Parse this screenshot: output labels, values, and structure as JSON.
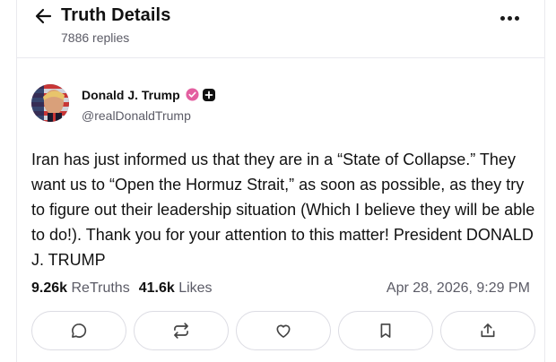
{
  "header": {
    "title": "Truth Details",
    "replies": "7886 replies"
  },
  "post": {
    "author_name": "Donald J. Trump",
    "author_handle": "@realDonaldTrump",
    "text": "Iran has just informed us that they are in a “State of Collapse.” They want us to “Open the Hormuz Strait,” as soon as possible, as they try to figure out their leadership situation (Which I believe they will be able to do!). Thank you for your attention to this matter! President DONALD J. TRUMP",
    "retruths_count": "9.26k",
    "retruths_label": "ReTruths",
    "likes_count": "41.6k",
    "likes_label": "Likes",
    "timestamp": "Apr 28, 2026, 9:29 PM"
  },
  "icons": {
    "back": "arrow-left-icon",
    "more": "more-horizontal-icon",
    "verified": "verified-badge-icon",
    "plus": "plus-badge-icon",
    "actions": [
      "reply-icon",
      "retruth-icon",
      "like-icon",
      "bookmark-icon",
      "share-icon"
    ]
  },
  "colors": {
    "verified_badge": "#e35fa0",
    "muted_text": "#5b5b66",
    "border": "#dcdce3"
  }
}
